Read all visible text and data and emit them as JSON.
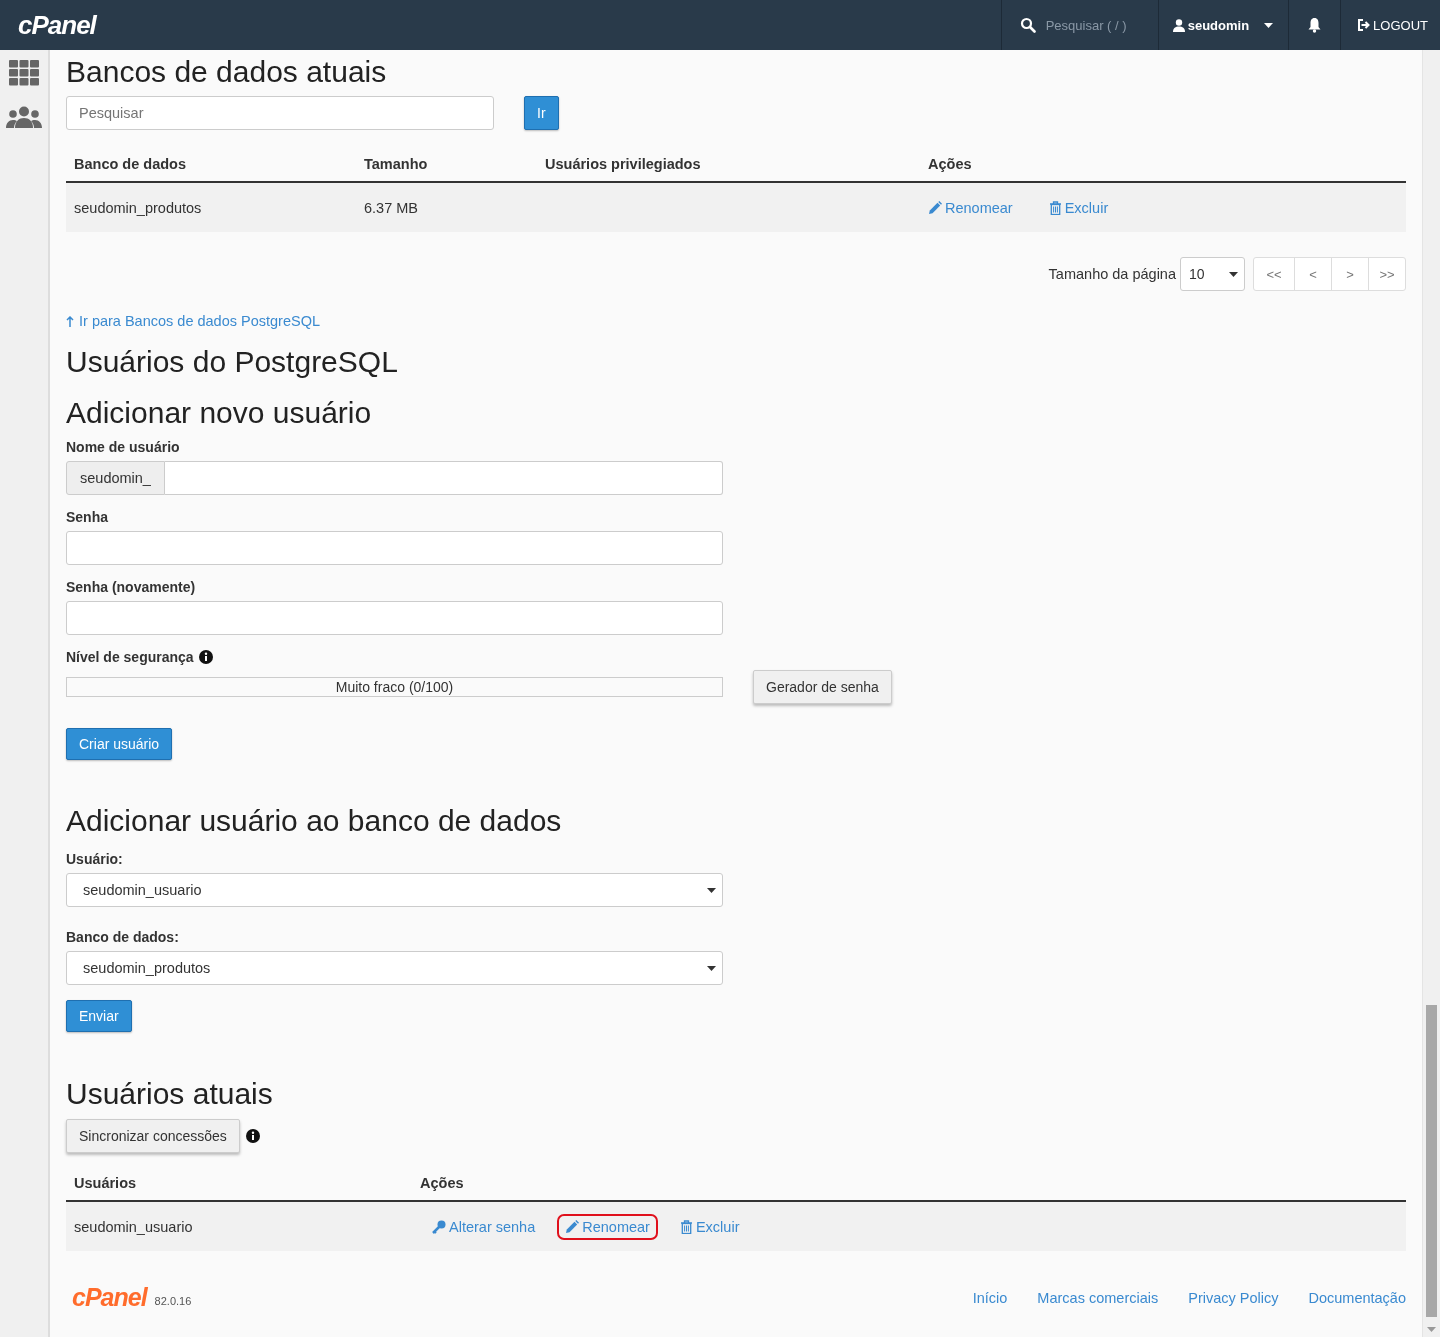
{
  "header": {
    "logo": "cPanel",
    "search_placeholder": "Pesquisar ( / )",
    "user": "seudomin",
    "logout": "LOGOUT"
  },
  "databases": {
    "title": "Bancos de dados atuais",
    "search": {
      "placeholder": "Pesquisar"
    },
    "search_button": "Ir",
    "columns": [
      "Banco de dados",
      "Tamanho",
      "Usuários privilegiados",
      "Ações"
    ],
    "rows": [
      {
        "name": "seudomin_produtos",
        "size": "6.37 MB",
        "actions": [
          {
            "kind": "rename",
            "label": "Renomear",
            "highlighted": false
          },
          {
            "kind": "delete",
            "label": "Excluir",
            "highlighted": false
          }
        ]
      }
    ],
    "page_size_label": "Tamanho da página",
    "page_size": "10",
    "pager": [
      "<<",
      "<",
      ">",
      ">>"
    ]
  },
  "jump_link": "Ir para Bancos de dados PostgreSQL",
  "users_title": "Usuários do PostgreSQL",
  "add_user": {
    "title": "Adicionar novo usuário",
    "fields": [
      {
        "label": "Nome de usuário",
        "prefix": "seudomin_"
      },
      {
        "label": "Senha"
      },
      {
        "label": "Senha (novamente)"
      }
    ],
    "strength": {
      "label": "Nível de segurança",
      "level": 0,
      "reading": "Muito fraco (0/100)"
    },
    "generator_button": "Gerador de senha",
    "submit": "Criar usuário"
  },
  "add_to_db": {
    "title": "Adicionar usuário ao banco de dados",
    "selects": [
      {
        "label": "Usuário:",
        "value": "seudomin_usuario"
      },
      {
        "label": "Banco de dados:",
        "value": "seudomin_produtos"
      }
    ],
    "submit": "Enviar"
  },
  "current_users": {
    "title": "Usuários atuais",
    "sync_button": "Sincronizar concessões",
    "columns": [
      "Usuários",
      "Ações"
    ],
    "rows": [
      {
        "name": "seudomin_usuario",
        "actions": [
          {
            "kind": "password",
            "label": "Alterar senha",
            "highlighted": false
          },
          {
            "kind": "rename",
            "label": "Renomear",
            "highlighted": true
          },
          {
            "kind": "delete",
            "label": "Excluir",
            "highlighted": false
          }
        ]
      }
    ]
  },
  "footer": {
    "logo": "cPanel",
    "version": "82.0.16",
    "links": [
      "Início",
      "Marcas comerciais",
      "Privacy Policy",
      "Documentação"
    ]
  }
}
